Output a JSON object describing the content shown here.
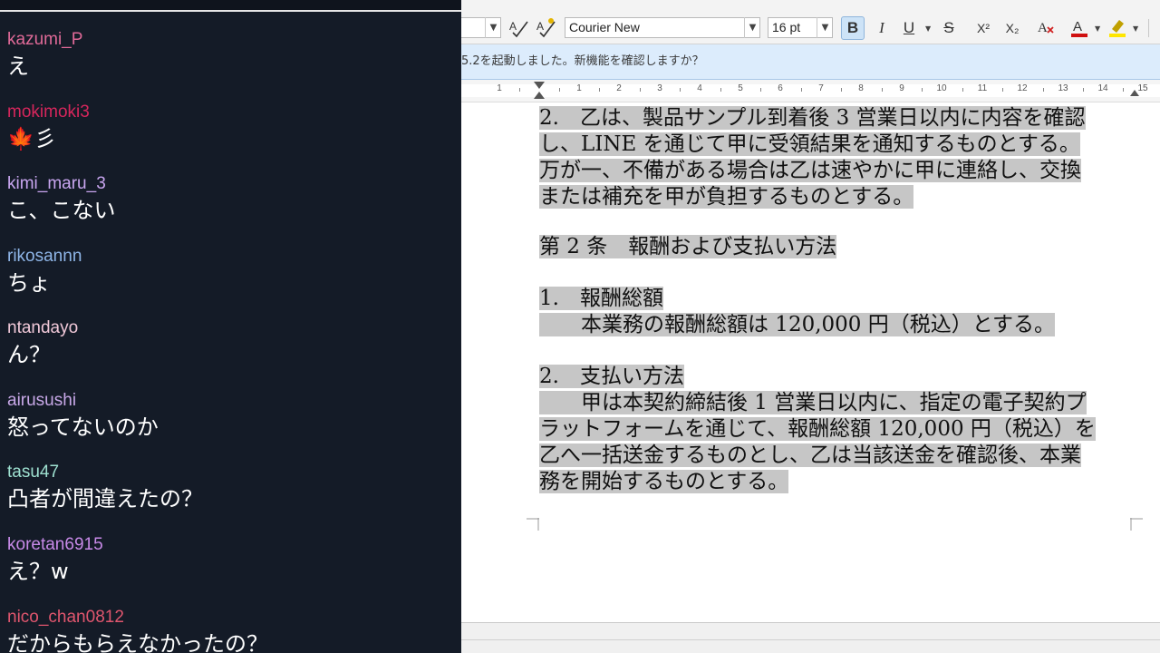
{
  "chat": {
    "messages": [
      {
        "user": "kazumi_P",
        "text": "え",
        "color": "#e06a98"
      },
      {
        "user": "mokimoki3",
        "text": "🍁彡",
        "color": "#d6265c"
      },
      {
        "user": "kimi_maru_3",
        "text": "こ、こない",
        "color": "#c9a6f0"
      },
      {
        "user": "rikosannn",
        "text": "ちょ",
        "color": "#8fb6e8"
      },
      {
        "user": "ntandayo",
        "text": "ん？",
        "color": "#f0c8d8"
      },
      {
        "user": "airusushi",
        "text": "怒ってないのか",
        "color": "#c8a8e8"
      },
      {
        "user": "tasu47",
        "text": "凸者が間違えたの？",
        "color": "#9ee0d0"
      },
      {
        "user": "koretan6915",
        "text": "え？w",
        "color": "#c88ae8"
      },
      {
        "user": "nico_chan0812",
        "text": "だからもらえなかったの？",
        "color": "#e0566e"
      }
    ]
  },
  "writer": {
    "toolbar": {
      "font_name": "Courier New",
      "font_size": "16 pt",
      "bold_label": "B",
      "italic_label": "I",
      "underline_label": "U",
      "strike_label": "S",
      "superscript_label": "X²",
      "subscript_label": "X₂"
    },
    "infobar_text": "5.2を起動しました。新機能を確認しますか？",
    "ruler": [
      "1",
      "1",
      "2",
      "3",
      "4",
      "5",
      "6",
      "7",
      "8",
      "9",
      "10",
      "11",
      "12",
      "13",
      "14",
      "15"
    ],
    "document": {
      "clause1_item2": [
        "2.　乙は、製品サンプル到着後 3 営業日以内に内容を確認",
        "し、LINE を通じて甲に受領結果を通知するものとする。",
        "万が一、不備がある場合は乙は速やかに甲に連絡し、交換",
        "または補充を甲が負担するものとする。"
      ],
      "article2_title": "第 2 条　報酬および支払い方法",
      "item1_title": "1.　報酬総額",
      "item1_body": "　　本業務の報酬総額は 120,000 円（税込）とする。",
      "item2_title": "2.　支払い方法",
      "item2_body": [
        "　　甲は本契約締結後 1 営業日以内に、指定の電子契約プ",
        "ラットフォームを通じて、報酬総額 120,000 円（税込）を",
        "乙へ一括送金するものとし、乙は当該送金を確認後、本業",
        "務を開始するものとする。"
      ]
    }
  }
}
